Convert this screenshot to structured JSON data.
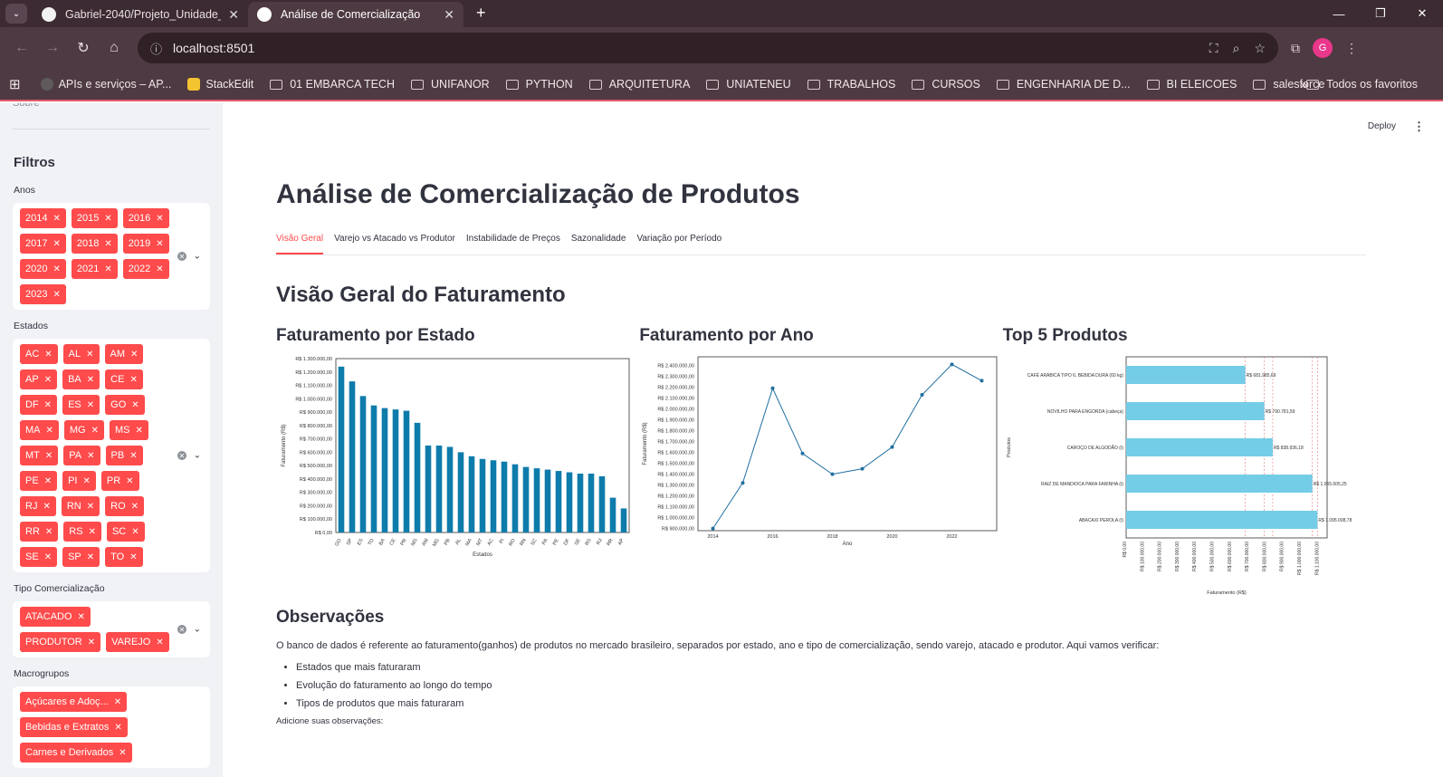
{
  "browser": {
    "tabs": [
      {
        "title": "Gabriel-2040/Projeto_Unidade_"
      },
      {
        "title": "Análise de Comercialização"
      }
    ],
    "url": "localhost:8501",
    "avatar_letter": "G",
    "bookmarks": [
      "APIs e serviços – AP...",
      "StackEdit",
      "01 EMBARCA TECH",
      "UNIFANOR",
      "PYTHON",
      "ARQUITETURA",
      "UNIATENEU",
      "TRABALHOS",
      "CURSOS",
      "ENGENHARIA DE D...",
      "BI ELEICOES",
      "salesforce"
    ],
    "bookmarks_more": "»",
    "all_favorites": "Todos os favoritos"
  },
  "sidebar": {
    "sobre": "Sobre",
    "filters_title": "Filtros",
    "anos_label": "Anos",
    "anos": [
      "2014",
      "2015",
      "2016",
      "2017",
      "2018",
      "2019",
      "2020",
      "2021",
      "2022",
      "2023"
    ],
    "estados_label": "Estados",
    "estados": [
      "AC",
      "AL",
      "AM",
      "AP",
      "BA",
      "CE",
      "DF",
      "ES",
      "GO",
      "MA",
      "MG",
      "MS",
      "MT",
      "PA",
      "PB",
      "PE",
      "PI",
      "PR",
      "RJ",
      "RN",
      "RO",
      "RR",
      "RS",
      "SC",
      "SE",
      "SP",
      "TO"
    ],
    "tipo_label": "Tipo Comercialização",
    "tipos": [
      "ATACADO",
      "PRODUTOR",
      "VAREJO"
    ],
    "macro_label": "Macrogrupos",
    "macrogrupos": [
      "Açúcares e Adoç...",
      "Bebidas e Extratos",
      "Carnes e Derivados"
    ]
  },
  "header": {
    "deploy": "Deploy",
    "menu": "⋮"
  },
  "main": {
    "title": "Análise de Comercialização de Produtos",
    "tabs": [
      "Visão Geral",
      "Varejo vs Atacado vs Produtor",
      "Instabilidade de Preços",
      "Sazonalidade",
      "Variação por Período"
    ],
    "section_title": "Visão Geral do Faturamento",
    "chart1_title": "Faturamento por Estado",
    "chart2_title": "Faturamento por Ano",
    "chart3_title": "Top 5 Produtos",
    "obs_title": "Observações",
    "obs_text": "O banco de dados é referente ao faturamento(ganhos) de produtos no mercado brasileiro, separados por estado, ano e tipo de comercialização, sendo varejo, atacado e produtor. Aqui vamos verificar:",
    "obs_items": [
      "Estados que mais faturaram",
      "Evolução do faturamento ao longo do tempo",
      "Tipos de produtos que mais faturaram"
    ],
    "add_obs": "Adicione suas observações:"
  },
  "colors": {
    "accent": "#ff4b4b",
    "bar1": "#0e7cab",
    "line": "#1f6f9f",
    "bar3": "#74cde6"
  },
  "chart_data": [
    {
      "type": "bar",
      "xlabel": "Estados",
      "ylabel": "Faturamento (R$)",
      "categories": [
        "GO",
        "SP",
        "ES",
        "TO",
        "BA",
        "CE",
        "PR",
        "MS",
        "AM",
        "MG",
        "PB",
        "AL",
        "MA",
        "MT",
        "AC",
        "PI",
        "RO",
        "RN",
        "SC",
        "PA",
        "PE",
        "DF",
        "SE",
        "RS",
        "RJ",
        "RR",
        "AP"
      ],
      "values": [
        1240000,
        1130000,
        1020000,
        950000,
        930000,
        920000,
        910000,
        820000,
        650000,
        650000,
        640000,
        600000,
        570000,
        550000,
        540000,
        530000,
        510000,
        490000,
        480000,
        470000,
        460000,
        450000,
        440000,
        440000,
        420000,
        260000,
        180000
      ],
      "ylim": [
        0,
        1300000
      ],
      "yticks": [
        0,
        100000,
        200000,
        300000,
        400000,
        500000,
        600000,
        700000,
        800000,
        900000,
        1000000,
        1100000,
        1200000,
        1300000
      ],
      "ytick_labels": [
        "R$ 0,00",
        "R$ 100.000,00",
        "R$ 200.000,00",
        "R$ 300.000,00",
        "R$ 400.000,00",
        "R$ 500.000,00",
        "R$ 600.000,00",
        "R$ 700.000,00",
        "R$ 800.000,00",
        "R$ 900.000,00",
        "R$ 1.000.000,00",
        "R$ 1.100.000,00",
        "R$ 1.200.000,00",
        "R$ 1.300.000,00"
      ]
    },
    {
      "type": "line",
      "xlabel": "Ano",
      "ylabel": "Faturamento (R$)",
      "x": [
        2014,
        2015,
        2016,
        2017,
        2018,
        2019,
        2020,
        2021,
        2022,
        2023
      ],
      "values": [
        900000,
        1320000,
        2190000,
        1590000,
        1400000,
        1450000,
        1650000,
        2130000,
        2410000,
        2260000
      ],
      "ylim": [
        880000,
        2480000
      ],
      "xticks": [
        2014,
        2016,
        2018,
        2020,
        2022
      ],
      "yticks": [
        900000,
        1000000,
        1100000,
        1200000,
        1300000,
        1400000,
        1500000,
        1600000,
        1700000,
        1800000,
        1900000,
        2000000,
        2100000,
        2200000,
        2300000,
        2400000
      ],
      "ytick_labels": [
        "R$ 900.000,00",
        "R$ 1.000.000,00",
        "R$ 1.100.000,00",
        "R$ 1.200.000,00",
        "R$ 1.300.000,00",
        "R$ 1.400.000,00",
        "R$ 1.500.000,00",
        "R$ 1.600.000,00",
        "R$ 1.700.000,00",
        "R$ 1.800.000,00",
        "R$ 1.900.000,00",
        "R$ 2.000.000,00",
        "R$ 2.100.000,00",
        "R$ 2.200.000,00",
        "R$ 2.300.000,00",
        "R$ 2.400.000,00"
      ]
    },
    {
      "type": "bar",
      "orientation": "horizontal",
      "xlabel": "Faturamento (R$)",
      "ylabel": "Produtos",
      "categories": [
        "CAFÉ ARÁBICA TIPO 6, BEBIDA DURA (60 kg)",
        "NOVILHO PARA ENGORDA (cabeça)",
        "CAROÇO DE ALGODÃO (t)",
        "RAIZ DE MANDIOCA PARA FARINHA (t)",
        "ABACAXI PEROLA (t)"
      ],
      "values": [
        681985.69,
        790781.59,
        838936.18,
        1065605.25,
        1095008.78
      ],
      "value_labels": [
        "R$ 681.985,69",
        "R$ 790.781,59",
        "R$ 838.936,18",
        "R$ 1.065.605,25",
        "R$ 1.095.008,78"
      ],
      "xlim": [
        0,
        1150000
      ],
      "xticks": [
        0,
        100000,
        200000,
        300000,
        400000,
        500000,
        600000,
        700000,
        800000,
        900000,
        1000000,
        1100000
      ],
      "xtick_labels": [
        "R$ 0,00",
        "R$ 100.000,00",
        "R$ 200.000,00",
        "R$ 300.000,00",
        "R$ 400.000,00",
        "R$ 500.000,00",
        "R$ 600.000,00",
        "R$ 700.000,00",
        "R$ 800.000,00",
        "R$ 900.000,00",
        "R$ 1.000.000,00",
        "R$ 1.100.000,00"
      ]
    }
  ]
}
